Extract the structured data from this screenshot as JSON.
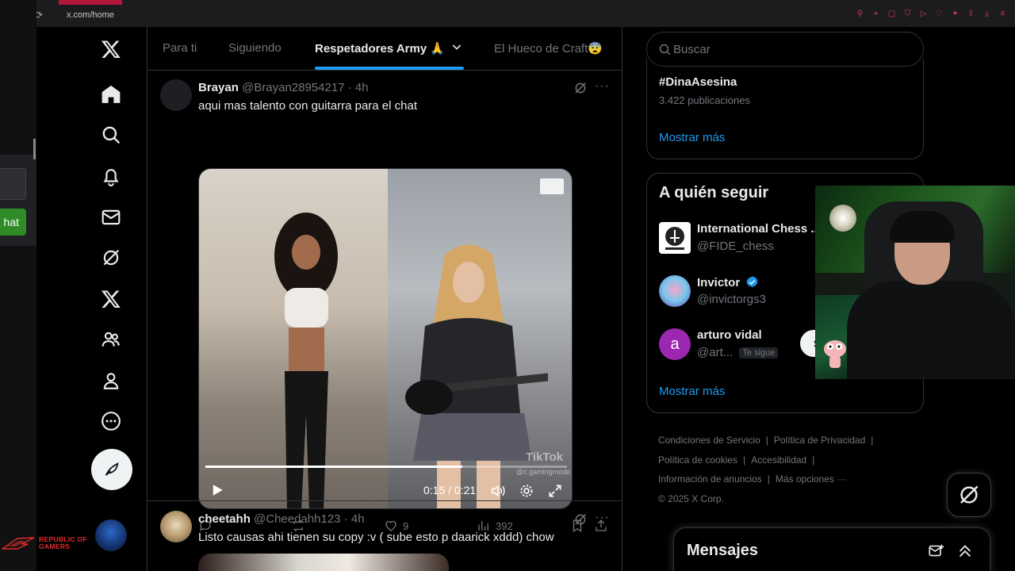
{
  "browser": {
    "url": "x.com/home"
  },
  "left_overlay": {
    "chat_label": "hat"
  },
  "rog": {
    "text_line1": "REPUBLIC OF",
    "text_line2": "GAMERS"
  },
  "tabs": [
    {
      "label": "Para ti",
      "active": false
    },
    {
      "label": "Siguiendo",
      "active": false
    },
    {
      "label": "Respetadores Army 🙏",
      "active": true
    },
    {
      "label": "El Hueco de Craft😨",
      "active": false
    }
  ],
  "posts": [
    {
      "name": "Brayan",
      "handle": "@Brayan28954217",
      "time": "4h",
      "text": "aqui mas talento con guitarra para el chat",
      "video": {
        "time": "0:15 / 0:21",
        "progress": 0.71,
        "watermark": "TikTok",
        "watermark_sub": "@c.gamingmode"
      },
      "likes": "9",
      "views": "392"
    },
    {
      "name": "cheetahh",
      "handle": "@Cheedahh123",
      "time": "4h",
      "text": "Listo causas ahi tienen su copy :v ( sube esto p daarick xddd) chow"
    }
  ],
  "search": {
    "placeholder": "Buscar"
  },
  "trend": {
    "tag": "#DinaAsesina",
    "count": "3.422 publicaciones",
    "show_more": "Mostrar más"
  },
  "who_to_follow": {
    "title": "A quién seguir",
    "accounts": [
      {
        "name": "International Chess ...",
        "handle": "@FIDE_chess"
      },
      {
        "name": "Invictor",
        "handle": "@invictorgs3",
        "verified": true
      },
      {
        "name": "arturo vidal",
        "handle": "@art...",
        "follows_you": "Te sigue",
        "avatar_letter": "a",
        "button": "Se"
      }
    ],
    "show_more": "Mostrar más"
  },
  "footer": {
    "links": [
      "Condiciones de Servicio",
      "Política de Privacidad",
      "Política de cookies",
      "Accesibilidad",
      "Información de anuncios",
      "Más opciones ···"
    ],
    "copyright": "© 2025 X Corp."
  },
  "messages": {
    "title": "Mensajes"
  },
  "colors": {
    "accent": "#1d9bf0",
    "bg": "#000000",
    "border": "#2f3336",
    "muted": "#71767b"
  }
}
